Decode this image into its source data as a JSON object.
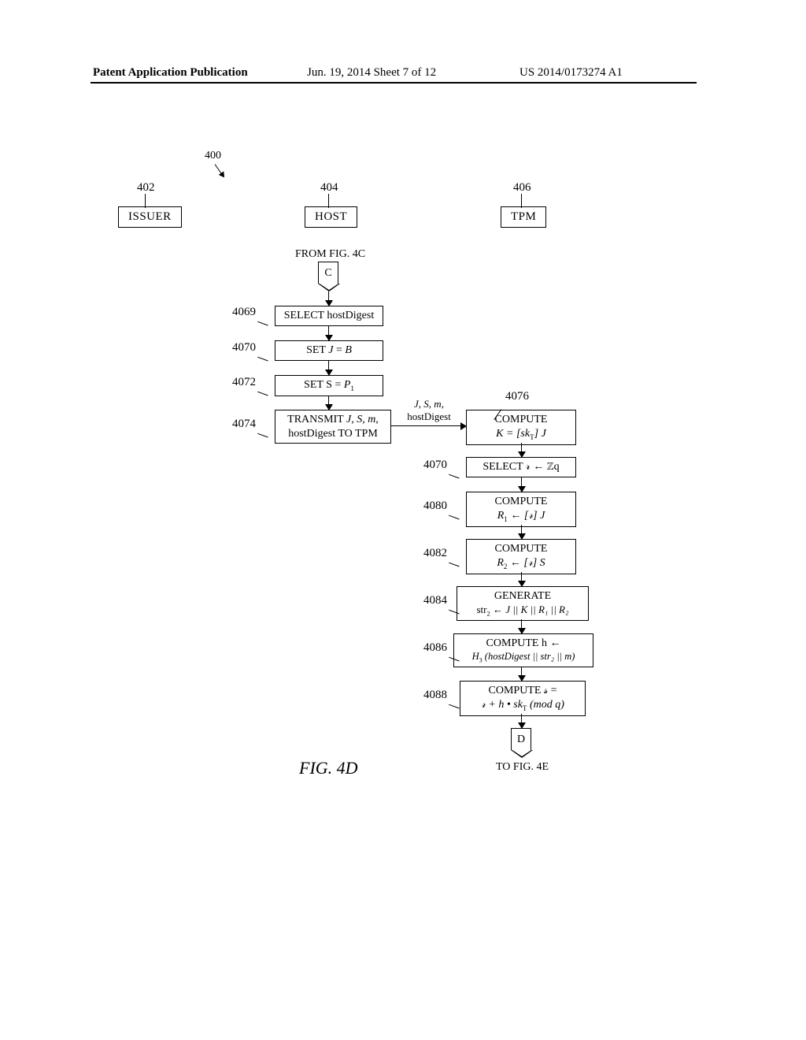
{
  "header": {
    "left": "Patent Application Publication",
    "mid": "Jun. 19, 2014  Sheet 7 of 12",
    "right": "US 2014/0173274 A1"
  },
  "refs": {
    "r400": "400",
    "r402": "402",
    "r404": "404",
    "r406": "406",
    "r4069": "4069",
    "r4070a": "4070",
    "r4072": "4072",
    "r4074": "4074",
    "r4076": "4076",
    "r4070b": "4070",
    "r4080": "4080",
    "r4082": "4082",
    "r4084": "4084",
    "r4086": "4086",
    "r4088": "4088"
  },
  "cols": {
    "issuer": "ISSUER",
    "host": "HOST",
    "tpm": "TPM"
  },
  "offpage": {
    "c": "C",
    "d": "D",
    "from": "FROM FIG. 4C",
    "to": "TO FIG. 4E"
  },
  "hostSteps": {
    "s4069": "SELECT hostDigest",
    "s4070_pre": "SET ",
    "s4070_j": "J",
    "s4070_eq": " = ",
    "s4070_b": "B",
    "s4072_pre": "SET S = ",
    "s4072_p": "P",
    "s4072_sub": "1",
    "s4074_l1_pre": "TRANSMIT ",
    "s4074_l1_jsm": "J, S, m,",
    "s4074_l2": "hostDigest TO TPM"
  },
  "msg": {
    "l1": "J, S, m,",
    "l2": "hostDigest"
  },
  "tpmSteps": {
    "s4076_l1": "COMPUTE",
    "s4076_l2_pre": "K = [sk",
    "s4076_l2_sub": "T",
    "s4076_l2_post": "] J",
    "s4070b": "SELECT 𝓇 ← ℤq",
    "s4080_l1": "COMPUTE",
    "s4080_l2": "R",
    "s4080_l2_sub": "1",
    "s4080_l2_post": " ← [𝓇] J",
    "s4082_l1": "COMPUTE",
    "s4082_l2": "R",
    "s4082_l2_sub": "2",
    "s4082_l2_post": " ← [𝓇] S",
    "s4084_l1": "GENERATE",
    "s4084_l2_pre": "str",
    "s4084_l2_sub": "2",
    "s4084_l2_post": " ← J || K || R₁ || R₂",
    "s4086_l1": "COMPUTE h ←",
    "s4086_l2_pre": "H",
    "s4086_l2_sub": "3",
    "s4086_l2_post": " (hostDigest || str₂ || m)",
    "s4088_l1": "COMPUTE 𝓈 =",
    "s4088_l2_pre": "𝓇 + h • sk",
    "s4088_l2_sub": "T",
    "s4088_l2_post": " (mod q)"
  },
  "figCaption": "FIG. 4D"
}
